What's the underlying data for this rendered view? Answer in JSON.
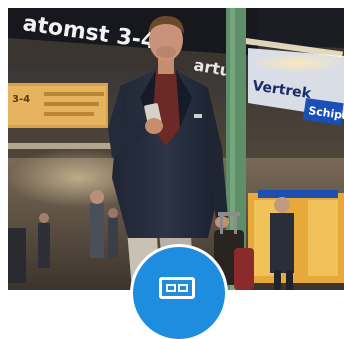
{
  "scene": {
    "signs": {
      "platform_sign": "atomst 3-4",
      "platform_sign_lower": "artu",
      "platform_left": "3-4",
      "vertrek": "Vertrek",
      "schiphol": "Schiph"
    }
  },
  "badge": {
    "icon": "card-icon",
    "color": "#1e8de0"
  }
}
